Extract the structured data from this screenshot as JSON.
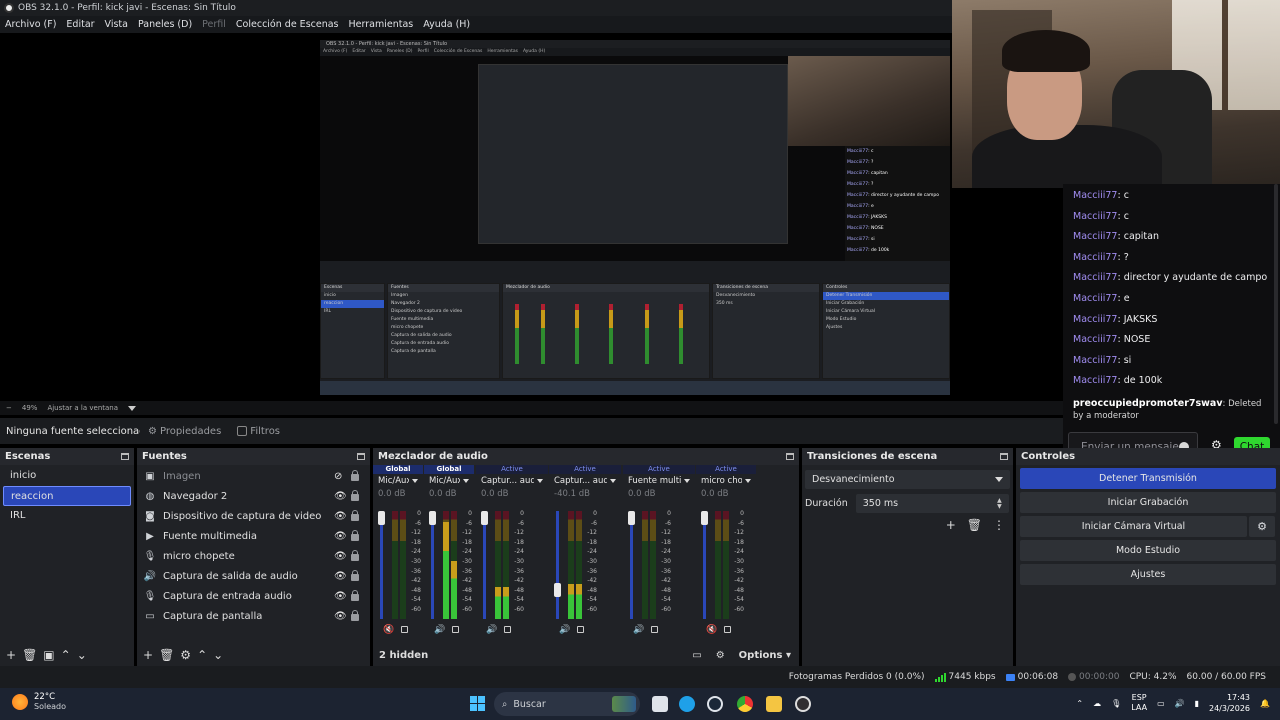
{
  "window_title": "OBS 32.1.0 - Perfil: kick javi - Escenas: Sin Título",
  "menu": [
    "Archivo (F)",
    "Editar",
    "Vista",
    "Paneles (D)",
    "Perfil",
    "Colección de Escenas",
    "Herramientas",
    "Ayuda (H)"
  ],
  "zoom": {
    "percent": "49%",
    "fit": "Ajustar a la ventana"
  },
  "context": {
    "no_source": "Ninguna fuente seleccionada",
    "properties": "Propiedades",
    "filters": "Filtros"
  },
  "scenes": {
    "title": "Escenas",
    "items": [
      "inicio",
      "reaccion",
      "IRL"
    ],
    "selected": "reaccion"
  },
  "sources": {
    "title": "Fuentes",
    "items": [
      {
        "label": "Imagen",
        "icon": "image-icon",
        "visible": false
      },
      {
        "label": "Navegador 2",
        "icon": "globe-icon",
        "visible": true
      },
      {
        "label": "Dispositivo de captura de video",
        "icon": "camera-icon",
        "visible": true
      },
      {
        "label": "Fuente multimedia",
        "icon": "play-icon",
        "visible": true
      },
      {
        "label": "micro chopete",
        "icon": "microphone-icon",
        "visible": true
      },
      {
        "label": "Captura de salida de audio",
        "icon": "speaker-icon",
        "visible": true
      },
      {
        "label": "Captura de entrada audio",
        "icon": "microphone-icon",
        "visible": true
      },
      {
        "label": "Captura de pantalla",
        "icon": "monitor-icon",
        "visible": true
      }
    ]
  },
  "mixer": {
    "title": "Mezclador de audio",
    "hidden_label": "2 hidden",
    "options_label": "Options",
    "ticks": [
      "0",
      "-6",
      "-12",
      "-18",
      "-24",
      "-30",
      "-36",
      "-42",
      "-48",
      "-54",
      "-60"
    ],
    "channels": [
      {
        "tag": "Global",
        "name": "Mic/Aux",
        "db": "0.0 dB",
        "level": 0,
        "muted": true
      },
      {
        "tag": "Global",
        "name": "Mic/Aux 2",
        "db": "0.0 dB",
        "level": 0.9,
        "muted": false
      },
      {
        "tag": "Active",
        "name": "Captur... audio",
        "db": "0.0 dB",
        "level": 0.3,
        "muted": false
      },
      {
        "tag": "Active",
        "name": "Captur... audio",
        "db": "-40.1 dB",
        "level": 0.32,
        "muted": false
      },
      {
        "tag": "Active",
        "name": "Fuente multimedia",
        "db": "0.0 dB",
        "level": 0,
        "muted": false
      },
      {
        "tag": "Active",
        "name": "micro chopete",
        "db": "0.0 dB",
        "level": 0,
        "muted": true
      }
    ]
  },
  "transitions": {
    "title": "Transiciones de escena",
    "selected": "Desvanecimiento",
    "duration_label": "Duración",
    "duration_value": "350 ms"
  },
  "controls": {
    "title": "Controles",
    "buttons": [
      "Detener Transmisión",
      "Iniciar Grabación",
      "Iniciar Cámara Virtual",
      "Modo Estudio",
      "Ajustes"
    ]
  },
  "chat": {
    "messages": [
      {
        "user": "Macciii77",
        "text": "c"
      },
      {
        "user": "Macciii77",
        "text": "c"
      },
      {
        "user": "Macciii77",
        "text": "capitan"
      },
      {
        "user": "Macciii77",
        "text": "?"
      },
      {
        "user": "Macciii77",
        "text": "director y ayudante de campo"
      },
      {
        "user": "Macciii77",
        "text": "e"
      },
      {
        "user": "Macciii77",
        "text": "JAKSKS"
      },
      {
        "user": "Macciii77",
        "text": "NOSE"
      },
      {
        "user": "Macciii77",
        "text": "si"
      },
      {
        "user": "Macciii77",
        "text": "de 100k"
      }
    ],
    "deleted": {
      "user": "preoccupiedpromoter7swav",
      "text": "Deleted by a moderator"
    },
    "input_placeholder": "Enviar un mensaje",
    "send_label": "Chat",
    "accent": "#2fd82f"
  },
  "status": {
    "dropped": "Fotogramas Perdidos 0 (0.0%)",
    "bitrate": "7445 kbps",
    "stream_time": "00:06:08",
    "rec_time": "00:00:00",
    "cpu": "CPU: 4.2%",
    "fps": "60.00 / 60.00 FPS"
  },
  "taskbar": {
    "temp": "22°C",
    "weather": "Soleado",
    "search": "Buscar",
    "lang1": "ESP",
    "lang2": "LAA",
    "time": "17:43",
    "date": "24/3/2026"
  },
  "nested": {
    "title": "OBS 32.1.0 - Perfil: kick javi - Escenas: Sin Título",
    "chat": [
      {
        "user": "Macciii77",
        "text": "c"
      },
      {
        "user": "Macciii77",
        "text": "?"
      },
      {
        "user": "Macciii77",
        "text": "capitan"
      },
      {
        "user": "Macciii77",
        "text": "?"
      },
      {
        "user": "Macciii77",
        "text": "director y ayudante de campo"
      },
      {
        "user": "Macciii77",
        "text": "e"
      },
      {
        "user": "Macciii77",
        "text": "JAKSKS"
      },
      {
        "user": "Macciii77",
        "text": "NOSE"
      },
      {
        "user": "Macciii77",
        "text": "si"
      },
      {
        "user": "Macciii77",
        "text": "de 100k"
      }
    ]
  }
}
